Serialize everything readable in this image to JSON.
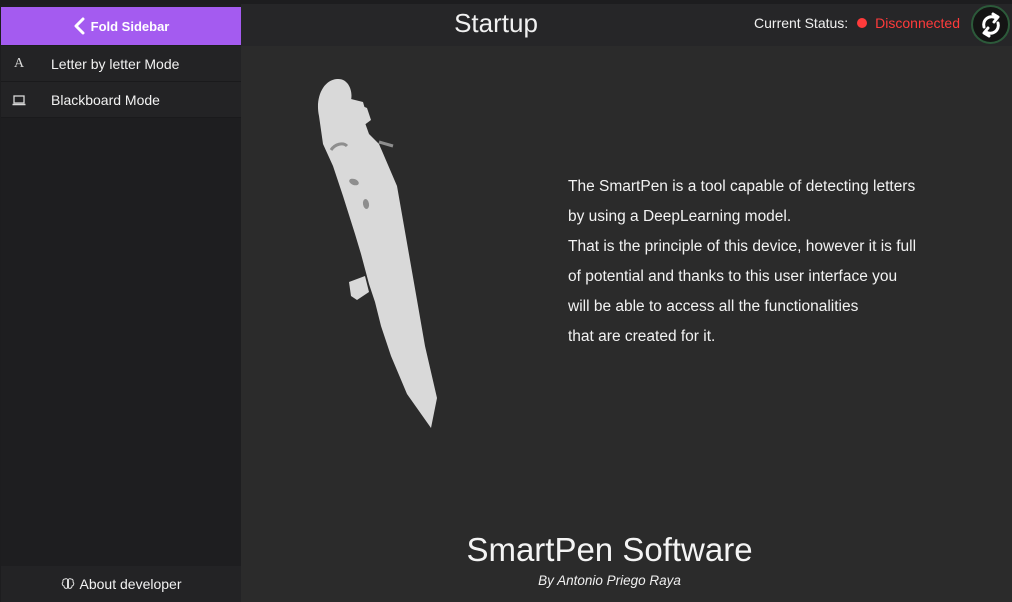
{
  "sidebar": {
    "fold_label": "Fold Sidebar",
    "items": [
      {
        "label": "Letter by letter Mode",
        "icon": "letter-a-icon",
        "glyph": "A"
      },
      {
        "label": "Blackboard Mode",
        "icon": "monitor-icon"
      }
    ],
    "about_label": "About developer"
  },
  "header": {
    "title": "Startup",
    "status_label": "Current Status:",
    "status_value": "Disconnected"
  },
  "main": {
    "description": [
      "The SmartPen is a tool capable of detecting letters",
      "by using a DeepLearning model.",
      "That is the principle of this device, however it is full",
      "of potential and thanks to this user interface you",
      "will be able to access all the functionalities",
      "that are created for it."
    ],
    "brand": "SmartPen Software",
    "author": "By Antonio Priego Raya"
  },
  "colors": {
    "accent": "#a45bf0",
    "status_disconnected": "#ff3b3b",
    "sync_ring": "#2c5a3a"
  }
}
